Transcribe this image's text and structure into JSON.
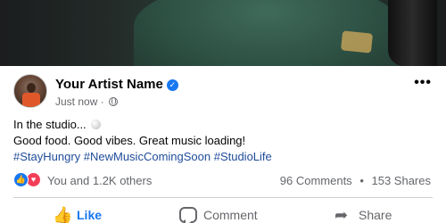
{
  "post": {
    "author": "Your Artist Name",
    "timestamp": "Just now",
    "separator": "·",
    "text_line1": "In the studio...",
    "text_line2": "Good food. Good vibes. Great music loading!",
    "hashtags": "#StayHungry #NewMusicComingSoon #StudioLife"
  },
  "engagement": {
    "reactions_text": "You and 1.2K others",
    "comments": "96 Comments",
    "dot": "•",
    "shares": "153 Shares"
  },
  "actions": {
    "like_label": "Like",
    "comment_label": "Comment",
    "share_label": "Share"
  },
  "icons": {
    "verified": "verified-badge-icon",
    "audience": "globe-icon",
    "more": "more-options-icon",
    "like_reaction": "like-reaction-icon",
    "love_reaction": "love-reaction-icon",
    "like": "thumbs-up-icon",
    "comment": "comment-bubble-icon",
    "share": "share-arrow-icon"
  },
  "colors": {
    "accent": "#1877f2",
    "love": "#f33e58",
    "secondary_text": "#65676b",
    "hashtag": "#1f4c99"
  }
}
